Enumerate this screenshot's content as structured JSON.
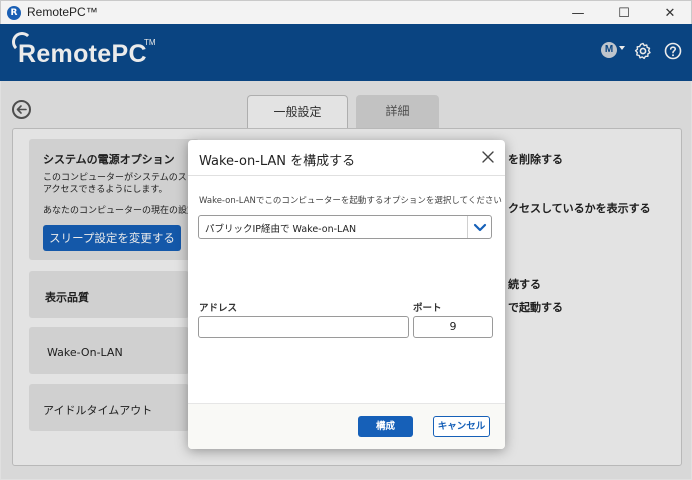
{
  "window": {
    "title": "RemotePC™",
    "app_icon_letter": "R",
    "minimize": "—",
    "maximize": "☐",
    "close": "✕"
  },
  "header": {
    "logo_text": "RemotePC",
    "logo_tm": "TM",
    "avatar_letter": "M",
    "icons": [
      "gear-icon",
      "help-icon"
    ],
    "brand_color": "#0b4a8c"
  },
  "tabs": [
    {
      "label": "一般設定",
      "active": true
    },
    {
      "label": "詳細",
      "active": false
    }
  ],
  "cards": {
    "power": {
      "title": "システムの電源オプション",
      "line1": "このコンピューターがシステムのスリープモー",
      "line2": "アクセスできるようにします。",
      "line3": "あなたのコンピューターの現在の設定：S",
      "button": "スリープ設定を変更する"
    },
    "quality": {
      "title": "表示品質"
    },
    "wol": {
      "title": "Wake-On-LAN"
    },
    "idle": {
      "title": "アイドルタイムアウト"
    }
  },
  "right_column": {
    "item1": "を削除する",
    "item2": "クセスしているかを表示する",
    "item3": "続する",
    "item4": "で起動する"
  },
  "dialog": {
    "title": "Wake-on-LAN を構成する",
    "description": "Wake-on-LANでこのコンピューターを起動するオプションを選択してください",
    "selected_option": "パブリックIP経由で Wake-on-LAN",
    "address_label": "アドレス",
    "address_value": "",
    "port_label": "ポート",
    "port_value": "9",
    "configure_button": "構成",
    "cancel_button": "キャンセル",
    "accent_color": "#1660b8"
  }
}
